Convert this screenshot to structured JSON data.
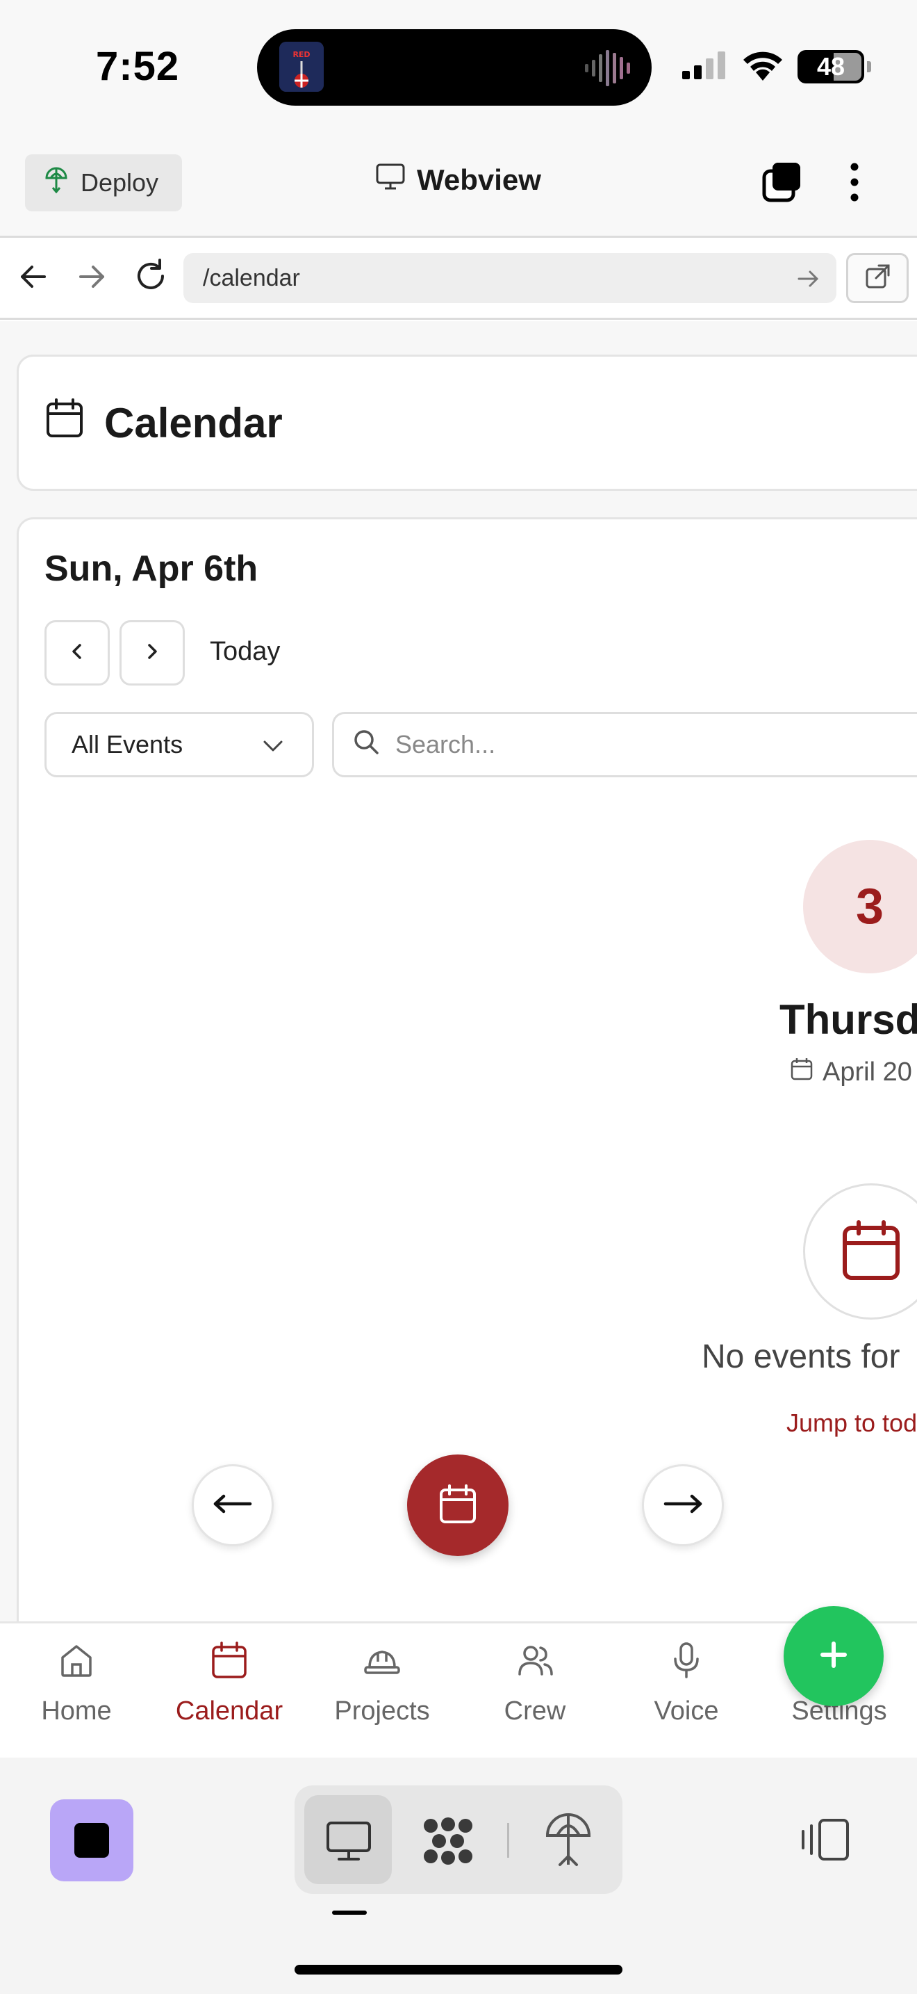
{
  "status_bar": {
    "time": "7:52",
    "battery": "48",
    "now_playing_art_text": "RED"
  },
  "toolbar": {
    "deploy_label": "Deploy",
    "title": "Webview"
  },
  "urlbar": {
    "url": "/calendar"
  },
  "page": {
    "title": "Calendar",
    "date_heading": "Sun, Apr 6th",
    "today_label": "Today",
    "filter_value": "All Events",
    "search_placeholder": "Search...",
    "day_number": "3",
    "day_name": "Thursda",
    "day_date": "April 20",
    "empty_message": "No events for",
    "jump_link": "Jump to tod"
  },
  "bottom_nav": {
    "items": [
      {
        "label": "Home",
        "icon": "home-icon"
      },
      {
        "label": "Calendar",
        "icon": "calendar-icon",
        "active": true
      },
      {
        "label": "Projects",
        "icon": "hardhat-icon"
      },
      {
        "label": "Crew",
        "icon": "users-icon"
      },
      {
        "label": "Voice",
        "icon": "mic-icon"
      },
      {
        "label": "Settings",
        "icon": "gear-icon"
      }
    ],
    "fab_icon": "plus-icon"
  },
  "colors": {
    "accent": "#9b1c1c",
    "accent_button": "#a5292b",
    "fab": "#22c55e",
    "dock_app": "#b9a6f7"
  }
}
